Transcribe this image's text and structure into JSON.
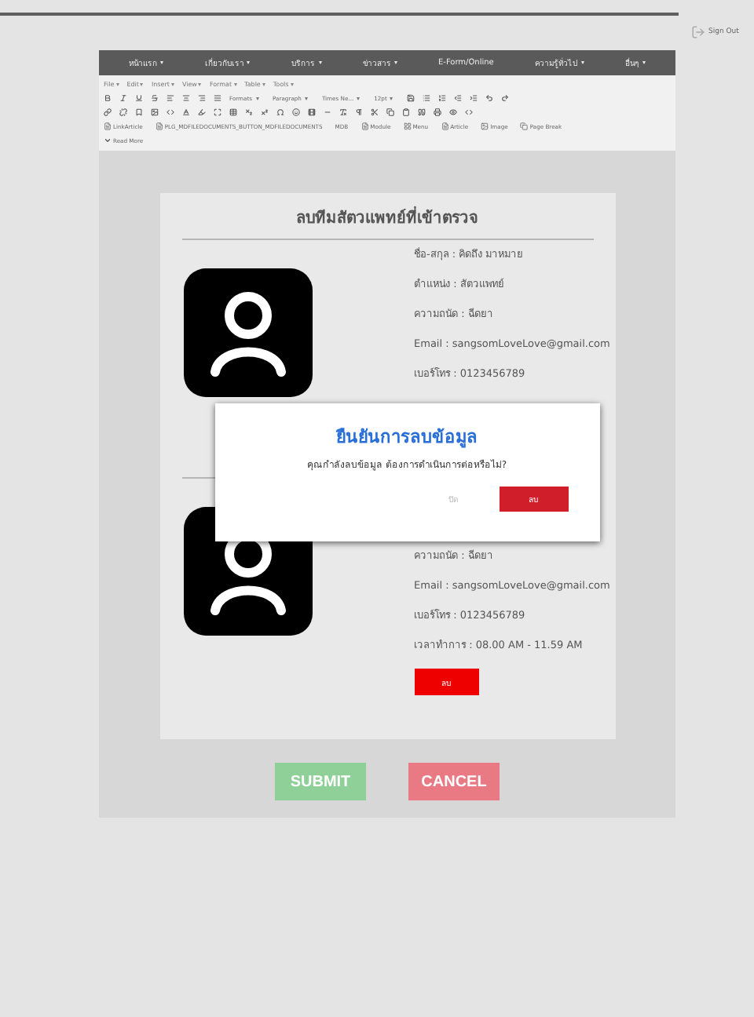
{
  "sign_out": {
    "label": "Sign Out"
  },
  "nav": [
    {
      "label": "หน้าแรก",
      "dropdown": true
    },
    {
      "label": "เกี่ยวกับเรา",
      "dropdown": true
    },
    {
      "label": "บริการ",
      "dropdown": true
    },
    {
      "label": "ข่าวสาร",
      "dropdown": true
    },
    {
      "label": "E-Form/Online",
      "dropdown": false
    },
    {
      "label": "ความรู้ทั่วไป",
      "dropdown": true
    },
    {
      "label": "อื่นๆ",
      "dropdown": true
    }
  ],
  "editor": {
    "menus": [
      "File",
      "Edit",
      "Insert",
      "View",
      "Format",
      "Table",
      "Tools"
    ],
    "dropdowns": [
      "Formats",
      "Paragraph",
      "Times Ne...",
      "12pt"
    ],
    "buttons": [
      {
        "label": "LinkArticle",
        "kind": "page"
      },
      {
        "label": "PLG_MDFILEDOCUMENTS_BUTTON_MDFILEDOCUMENTS",
        "kind": "page"
      },
      {
        "label": "MDB",
        "kind": "text"
      },
      {
        "label": "Module",
        "kind": "page"
      },
      {
        "label": "Menu",
        "kind": "menu"
      },
      {
        "label": "Article",
        "kind": "page"
      },
      {
        "label": "Image",
        "kind": "image"
      },
      {
        "label": "Page Break",
        "kind": "copy"
      }
    ],
    "read_more": "Read More"
  },
  "card": {
    "title": "ลบทีมสัตวแพทย์ที่เข้าตรวจ",
    "profiles": [
      {
        "lines": [
          "ชื่อ-สกุล : คิดถึง มาหมาย",
          "ตำแหน่ง : สัตวแพทย์",
          "ความถนัด : ฉีดยา",
          "Email : sangsomLoveLove@gmail.com",
          "เบอร์โทร : 0123456789"
        ]
      },
      {
        "lines": [
          "ความถนัด : ฉีดยา",
          "Email : sangsomLoveLove@gmail.com",
          "เบอร์โทร : 0123456789",
          "เวลาทำการ : 08.00 AM - 11.59 AM"
        ],
        "delete_button": "ลบ"
      }
    ]
  },
  "actions": {
    "submit": "SUBMIT",
    "cancel": "CANCEL"
  },
  "dialog": {
    "title": "ยืนยันการลบข้อมูล",
    "message": "คุณกำลังลบข้อมูล ต้องการดำเนินการต่อหรือไม่?",
    "cancel": "ปิด",
    "confirm": "ลบ"
  }
}
